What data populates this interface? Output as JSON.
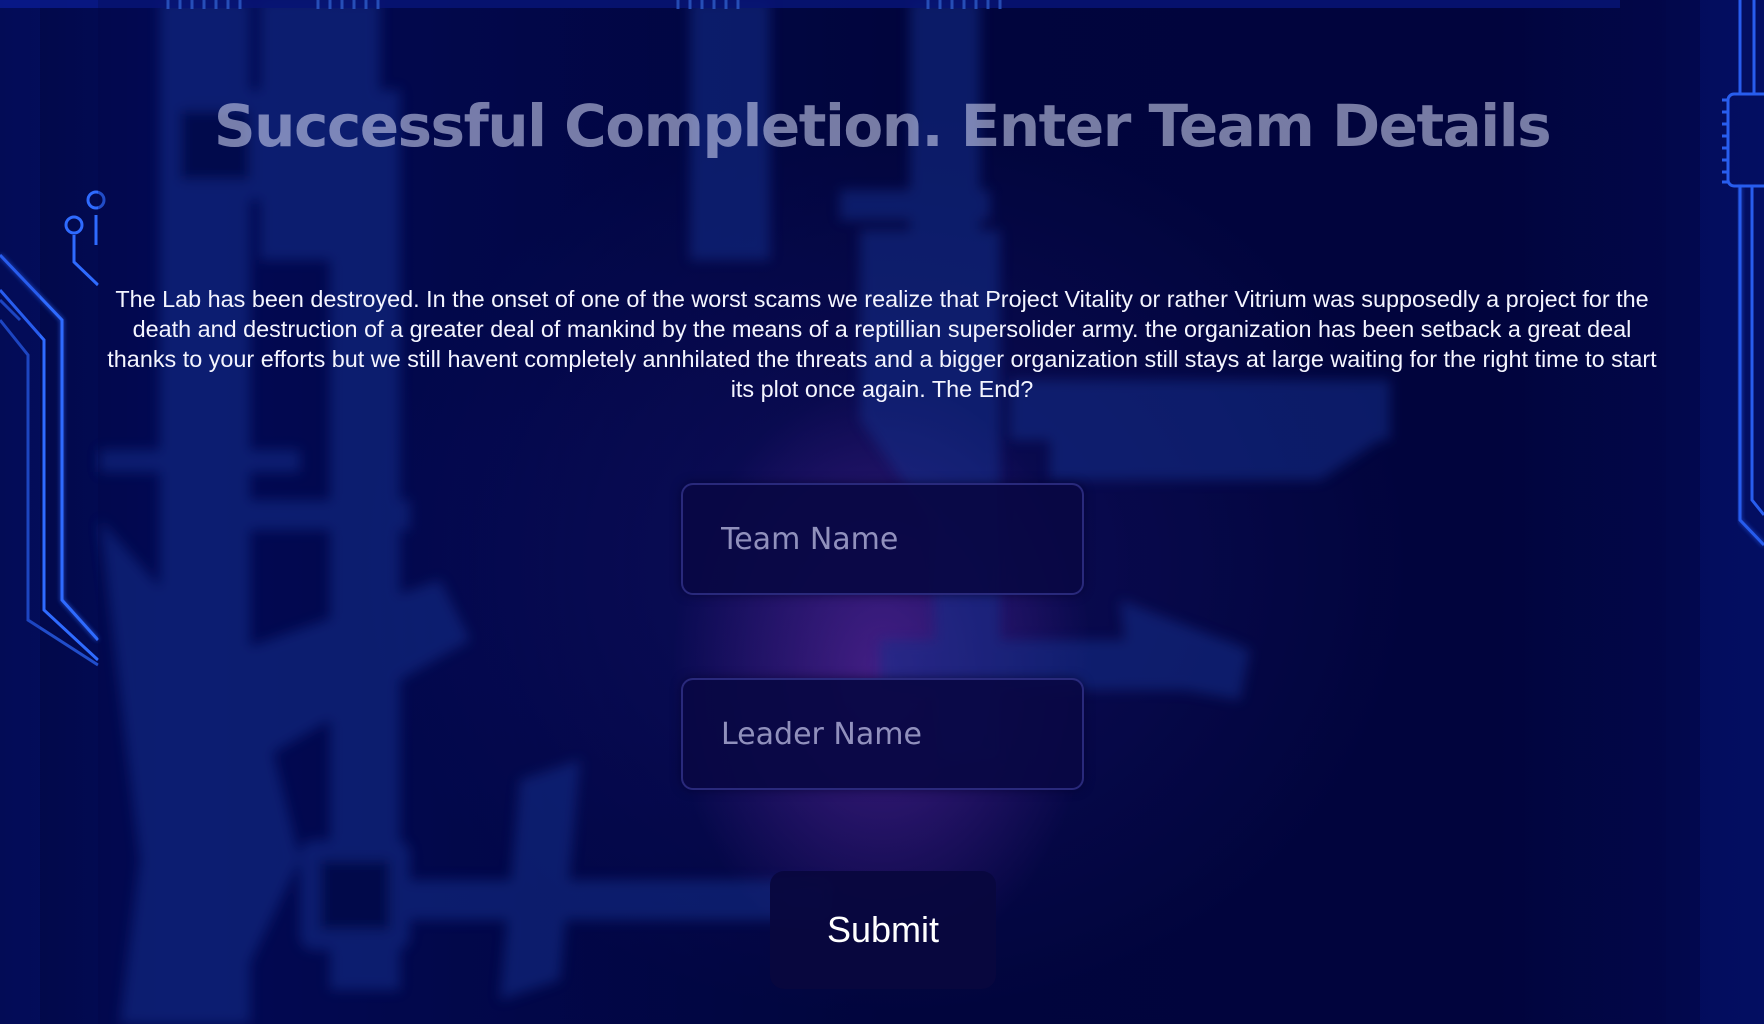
{
  "page": {
    "title": "Successful Completion. Enter Team Details",
    "story": "The Lab has been destroyed. In the onset of one of the worst scams we realize that Project Vitality or rather Vitrium was supposedly a project for the death and destruction of a greater deal of mankind by the means of a reptillian supersolider army. the organization has been setback a great deal thanks to your efforts but we still havent completely annhilated the threats and a bigger organization still stays at large waiting for the right time to start its plot once again. The End?"
  },
  "form": {
    "team_name_placeholder": "Team Name",
    "leader_name_placeholder": "Leader Name",
    "submit_label": "Submit"
  },
  "theme": {
    "background": "#01042a",
    "circuit_line": "#2f6bff",
    "glow": "#9a3fd6"
  }
}
